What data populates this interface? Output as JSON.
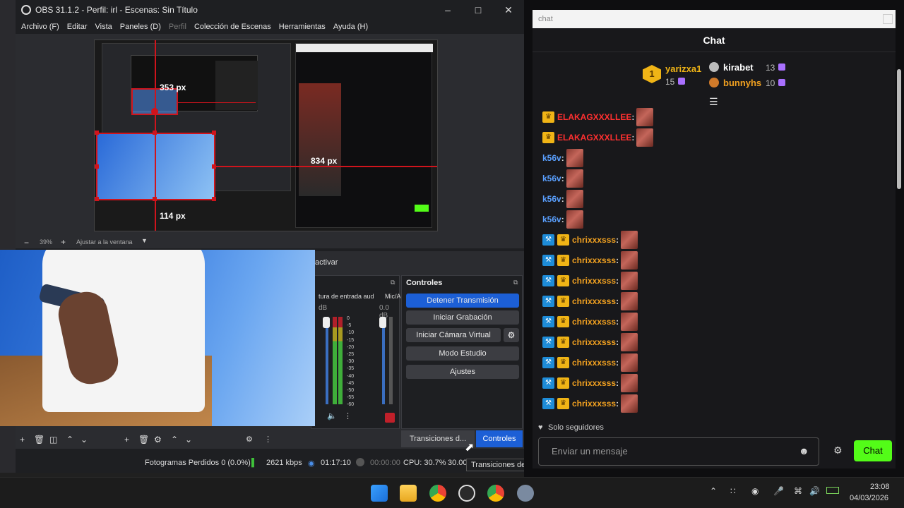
{
  "obs": {
    "title": "OBS 31.1.2 - Perfil: irl - Escenas: Sin Título",
    "menu": [
      "Archivo (F)",
      "Editar",
      "Vista",
      "Paneles (D)",
      "Perfil",
      "Colección de Escenas",
      "Herramientas",
      "Ayuda (H)"
    ],
    "preview": {
      "label_top": "353 px",
      "label_right": "834 px",
      "label_bottom": "114 px"
    },
    "zoom": {
      "value": "39%",
      "fit_label": "Ajustar a la ventana"
    },
    "activate_label": "activar",
    "audio": {
      "source1": "tura de entrada aud",
      "source2": "Mic/A",
      "db1": "dB",
      "db2": "0.0 dB",
      "ticks": [
        "0",
        "-5",
        "-10",
        "-15",
        "-20",
        "-25",
        "-30",
        "-35",
        "-40",
        "-45",
        "-50",
        "-55",
        "-60"
      ]
    },
    "controls": {
      "title": "Controles",
      "stop_stream": "Detener Transmisión",
      "start_recording": "Iniciar Grabación",
      "start_virtual_cam": "Iniciar Cámara Virtual",
      "studio_mode": "Modo Estudio",
      "settings": "Ajustes"
    },
    "tabs": {
      "transitions": "Transiciones d...",
      "controls": "Controles"
    },
    "tooltip": "Transiciones de escena",
    "status": {
      "dropped": "Fotogramas Perdidos 0 (0.0%)",
      "bitrate": "2621 kbps",
      "stream_time": "01:17:10",
      "rec_time": "00:00:00",
      "cpu": "CPU: 30.7%",
      "fps": "30.00"
    }
  },
  "chat": {
    "tab_title": "chat",
    "header": "Chat",
    "leaderboard": {
      "first": {
        "rank": "1",
        "name": "yarizxa1",
        "count": "15"
      },
      "second": {
        "name": "kirabet",
        "count": "13"
      },
      "third": {
        "name": "bunnyhs",
        "count": "10"
      }
    },
    "messages": [
      {
        "user": "ELAKAGXXXLLEE",
        "color": "#ff3030",
        "badges": [
          "crown"
        ]
      },
      {
        "user": "ELAKAGXXXLLEE",
        "color": "#ff3030",
        "badges": [
          "crown"
        ]
      },
      {
        "user": "k56v",
        "color": "#5aa0ff",
        "badges": []
      },
      {
        "user": "k56v",
        "color": "#5aa0ff",
        "badges": []
      },
      {
        "user": "k56v",
        "color": "#5aa0ff",
        "badges": []
      },
      {
        "user": "k56v",
        "color": "#5aa0ff",
        "badges": []
      },
      {
        "user": "chrixxxsss",
        "color": "#f0a020",
        "badges": [
          "mod",
          "crown"
        ]
      },
      {
        "user": "chrixxxsss",
        "color": "#f0a020",
        "badges": [
          "mod",
          "crown"
        ]
      },
      {
        "user": "chrixxxsss",
        "color": "#f0a020",
        "badges": [
          "mod",
          "crown"
        ]
      },
      {
        "user": "chrixxxsss",
        "color": "#f0a020",
        "badges": [
          "mod",
          "crown"
        ]
      },
      {
        "user": "chrixxxsss",
        "color": "#f0a020",
        "badges": [
          "mod",
          "crown"
        ]
      },
      {
        "user": "chrixxxsss",
        "color": "#f0a020",
        "badges": [
          "mod",
          "crown"
        ]
      },
      {
        "user": "chrixxxsss",
        "color": "#f0a020",
        "badges": [
          "mod",
          "crown"
        ]
      },
      {
        "user": "chrixxxsss",
        "color": "#f0a020",
        "badges": [
          "mod",
          "crown"
        ]
      },
      {
        "user": "chrixxxsss",
        "color": "#f0a020",
        "badges": [
          "mod",
          "crown"
        ]
      }
    ],
    "followers_only": "Solo seguidores",
    "input_placeholder": "Enviar un mensaje",
    "send_label": "Chat"
  },
  "taskbar": {
    "time": "23:08",
    "date": "04/03/2026",
    "icons": [
      "start-icon",
      "file-explorer-icon",
      "chrome-icon",
      "obs-icon",
      "chrome-profile-icon",
      "settings-icon"
    ]
  },
  "colors": {
    "accent_blue": "#1c5fd6",
    "obs_red": "#d0141c",
    "twitch_send_green": "#53fc18",
    "chat_bg": "#18181b"
  }
}
